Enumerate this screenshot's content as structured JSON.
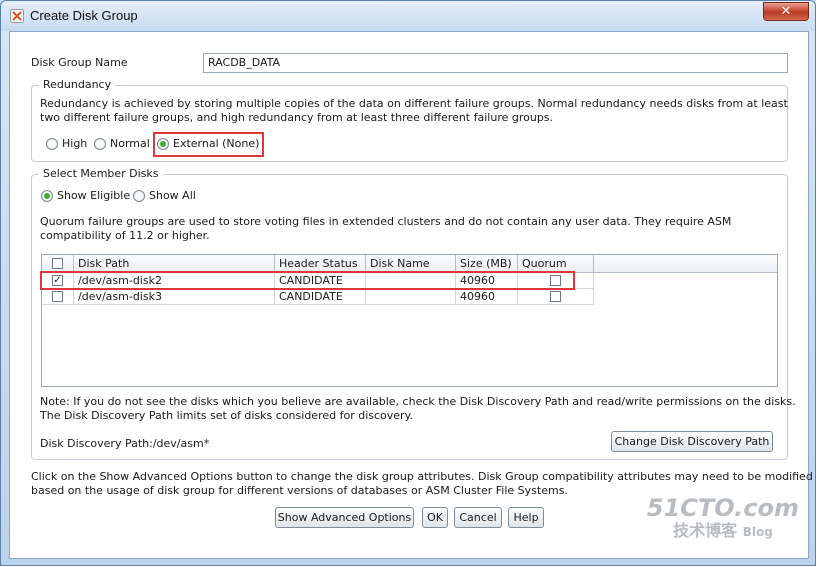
{
  "window": {
    "title": "Create Disk Group",
    "close_label": "✕"
  },
  "form": {
    "disk_group_name_label": "Disk Group Name",
    "disk_group_name_value": "RACDB_DATA"
  },
  "redundancy": {
    "legend": "Redundancy",
    "description_line1": "Redundancy is achieved by storing multiple copies of the data on different failure groups. Normal redundancy needs disks from at least",
    "description_line2": "two different failure groups, and high redundancy from at least three different failure groups.",
    "options": [
      {
        "label": "High",
        "selected": false
      },
      {
        "label": "Normal",
        "selected": false
      },
      {
        "label": "External (None)",
        "selected": true
      }
    ]
  },
  "member_disks": {
    "legend": "Select Member Disks",
    "filter_options": [
      {
        "label": "Show Eligible",
        "selected": true
      },
      {
        "label": "Show All",
        "selected": false
      }
    ],
    "quorum_note_line1": "Quorum failure groups are used to store voting files in extended clusters and do not contain any user data. They require ASM",
    "quorum_note_line2": "compatibility of 11.2 or higher.",
    "columns": [
      "Disk Path",
      "Header Status",
      "Disk Name",
      "Size (MB)",
      "Quorum"
    ],
    "rows": [
      {
        "selected": true,
        "disk_path": "/dev/asm-disk2",
        "header_status": "CANDIDATE",
        "disk_name": "",
        "size_mb": "40960",
        "quorum": false
      },
      {
        "selected": false,
        "disk_path": "/dev/asm-disk3",
        "header_status": "CANDIDATE",
        "disk_name": "",
        "size_mb": "40960",
        "quorum": false
      }
    ],
    "note_line1": "Note: If you do not see the disks which you believe are available, check the Disk Discovery Path and read/write permissions on the disks.",
    "note_line2": "The Disk Discovery Path limits set of disks considered for discovery.",
    "discovery_path_label": "Disk Discovery Path:/dev/asm*",
    "change_discovery_button": "Change Disk Discovery Path"
  },
  "footer": {
    "hint_line1": "Click on the Show Advanced Options button to change the disk group attributes. Disk Group compatibility attributes may need to be modified",
    "hint_line2": "based on the usage of disk group for different versions of databases or ASM Cluster File Systems.",
    "advanced_button": "Show Advanced Options",
    "ok_button": "OK",
    "cancel_button": "Cancel",
    "help_button": "Help"
  },
  "watermark": {
    "line1": "51CTO.com",
    "line2": "技术博客",
    "line3": "Blog"
  },
  "colors": {
    "highlight": "#e0383a",
    "radio_selected": "#3fae2a",
    "title_bar": "#c7dbf0"
  }
}
